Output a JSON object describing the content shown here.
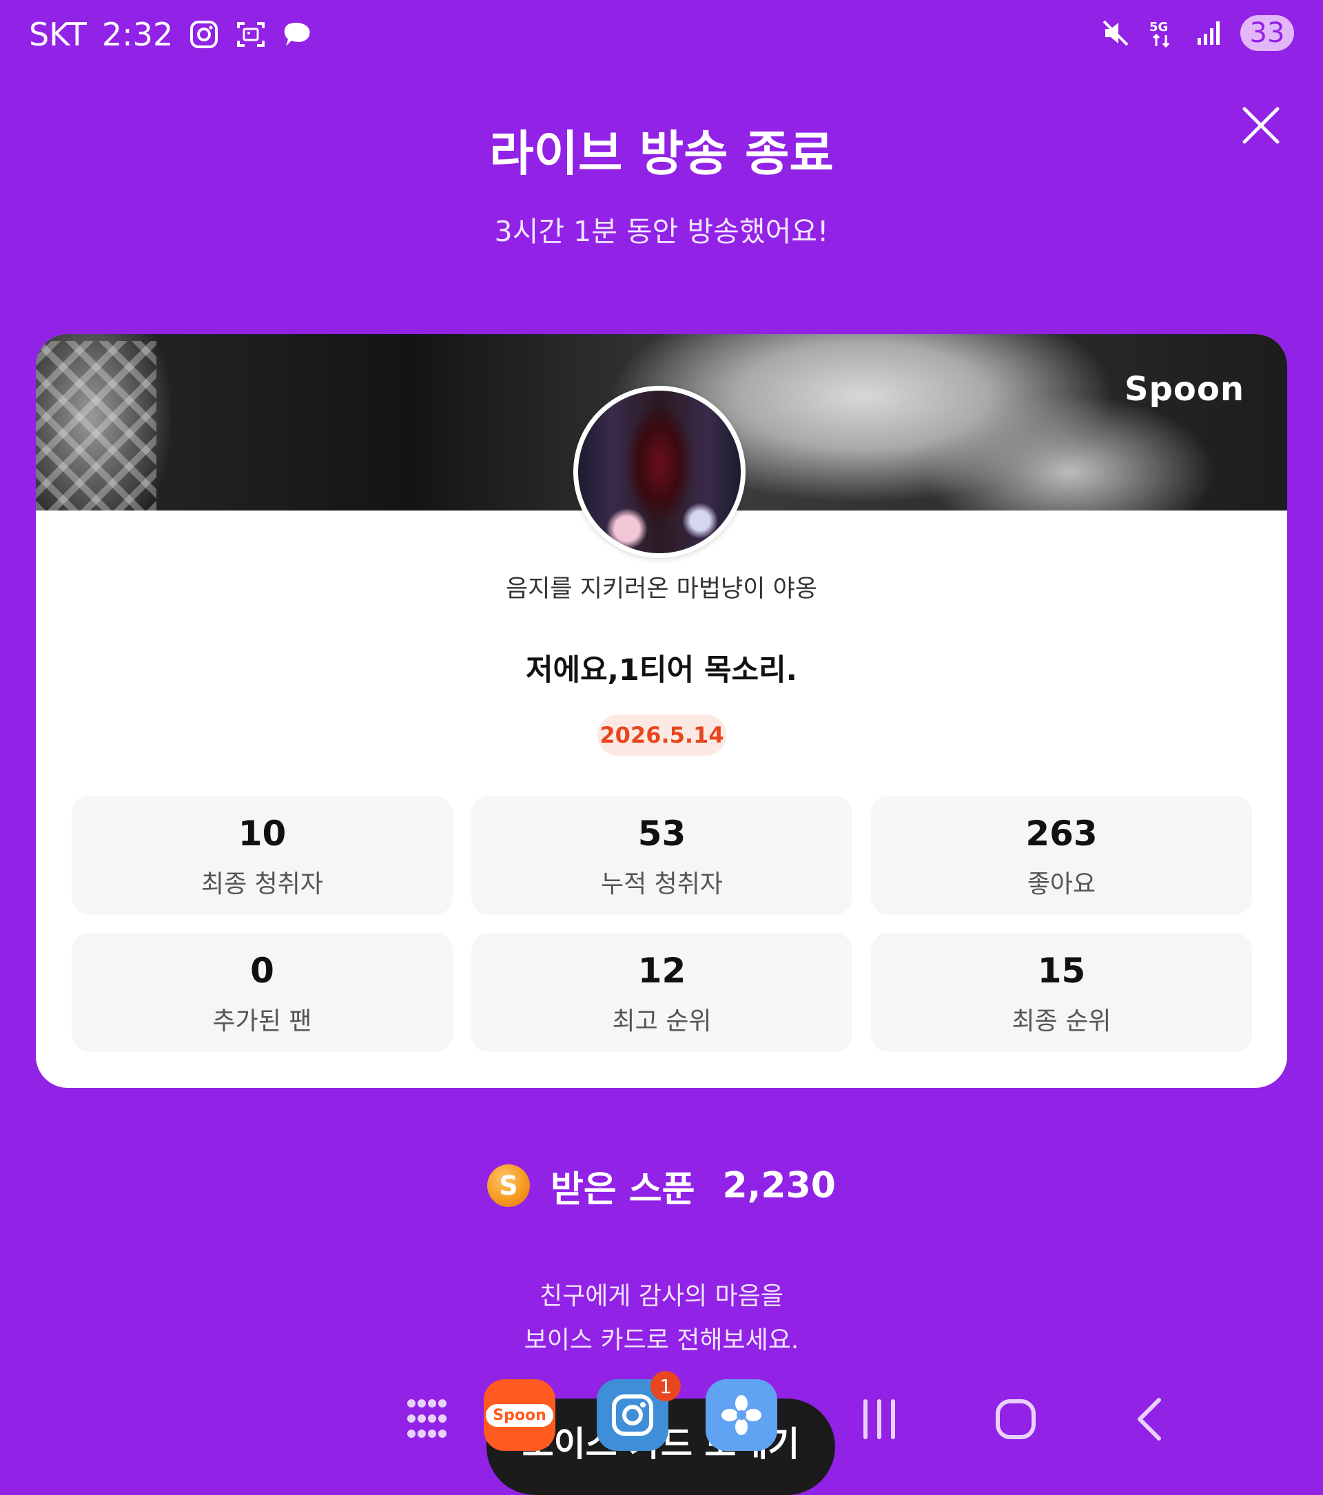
{
  "status_bar": {
    "carrier": "SKT",
    "time": "2:32",
    "network": "5G",
    "battery": "33"
  },
  "header": {
    "title": "라이브 방송 종료",
    "subtitle": "3시간 1분 동안 방송했어요!"
  },
  "card": {
    "brand": "Spoon",
    "host_name": "음지를 지키러온 마법냥이 야옹",
    "live_title": "저에요,1티어 목소리.",
    "date": "2026.5.14",
    "stats": [
      {
        "value": "10",
        "label": "최종 청취자"
      },
      {
        "value": "53",
        "label": "누적 청취자"
      },
      {
        "value": "263",
        "label": "좋아요"
      },
      {
        "value": "0",
        "label": "추가된 팬"
      },
      {
        "value": "12",
        "label": "최고 순위"
      },
      {
        "value": "15",
        "label": "최종 순위"
      }
    ]
  },
  "spoons": {
    "coin_letter": "S",
    "label": "받은 스푼",
    "value": "2,230"
  },
  "voice_card": {
    "line1": "친구에게 감사의 마음을",
    "line2": "보이스 카드로 전해보세요.",
    "button_label": "보이스 카드 보내기"
  },
  "dock": {
    "spoon_label": "Spoon",
    "instagram_badge": "1"
  },
  "colors": {
    "background": "#9222E6",
    "accent_date": "#E8461F",
    "card": "#FFFFFF"
  }
}
